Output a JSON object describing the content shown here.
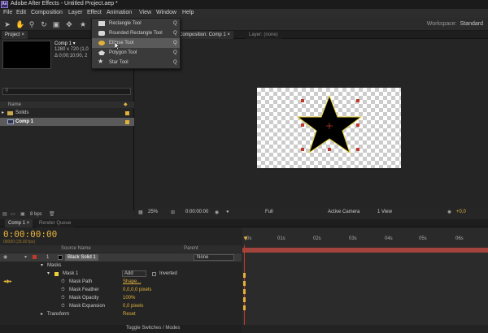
{
  "title": "Adobe After Effects - Untitled Project.aep *",
  "app_badge": "Ae",
  "menu": [
    "File",
    "Edit",
    "Composition",
    "Layer",
    "Effect",
    "Animation",
    "View",
    "Window",
    "Help"
  ],
  "workspace": {
    "label": "Workspace:",
    "value": "Standard"
  },
  "shape_menu": {
    "items": [
      {
        "label": "Rectangle Tool",
        "shortcut": "Q"
      },
      {
        "label": "Rounded Rectangle Tool",
        "shortcut": "Q"
      },
      {
        "label": "Ellipse Tool",
        "shortcut": "Q"
      },
      {
        "label": "Polygon Tool",
        "shortcut": "Q"
      },
      {
        "label": "Star Tool",
        "shortcut": "Q"
      }
    ],
    "highlighted": 2
  },
  "project": {
    "tab": "Project ×",
    "comp_name": "Comp 1 ▾",
    "comp_res": "1280 x 720 (1,0",
    "comp_dur": "Δ 0;00;10;00, 2",
    "search_placeholder": "⚲",
    "col_name": "Name",
    "rows": [
      "Solids",
      "Comp 1"
    ],
    "bpc": "8 bpc"
  },
  "viewer": {
    "tab1": "Composition: Comp 1 ×",
    "tab2": "Layer: (none)",
    "zoom": "25%",
    "time": "0:00:00:00",
    "res": "Full",
    "camera": "Active Camera",
    "views": "1 View",
    "exposure": "+0,0"
  },
  "timeline": {
    "tab": "Comp 1 ×",
    "tab2": "Render Queue",
    "timecode": "0:00:00:00",
    "fps": "00000 (25.00 fps)",
    "col_source": "Source Name",
    "col_parent": "Parent",
    "ruler": [
      "0s",
      "01s",
      "02s",
      "03s",
      "04s",
      "05s",
      "06s"
    ],
    "layer_num": "1",
    "layer_name": "Black Solid 1",
    "layer_parent": "None",
    "masks": "Masks",
    "mask1": "Mask 1",
    "mask_mode": "Add",
    "inverted": "Inverted",
    "props": [
      {
        "name": "Mask Path",
        "value": "Shape..."
      },
      {
        "name": "Mask Feather",
        "value": "0,0,0,0 pixels"
      },
      {
        "name": "Mask Opacity",
        "value": "100%"
      },
      {
        "name": "Mask Expansion",
        "value": "0,0 pixels"
      }
    ],
    "transform": "Transform",
    "reset": "Reset",
    "footer": "Toggle Switches / Modes"
  },
  "colors": {
    "accent": "#e2b13c",
    "layer_bar": "#a2443d",
    "menu_highlight": "#5a5a5a"
  }
}
